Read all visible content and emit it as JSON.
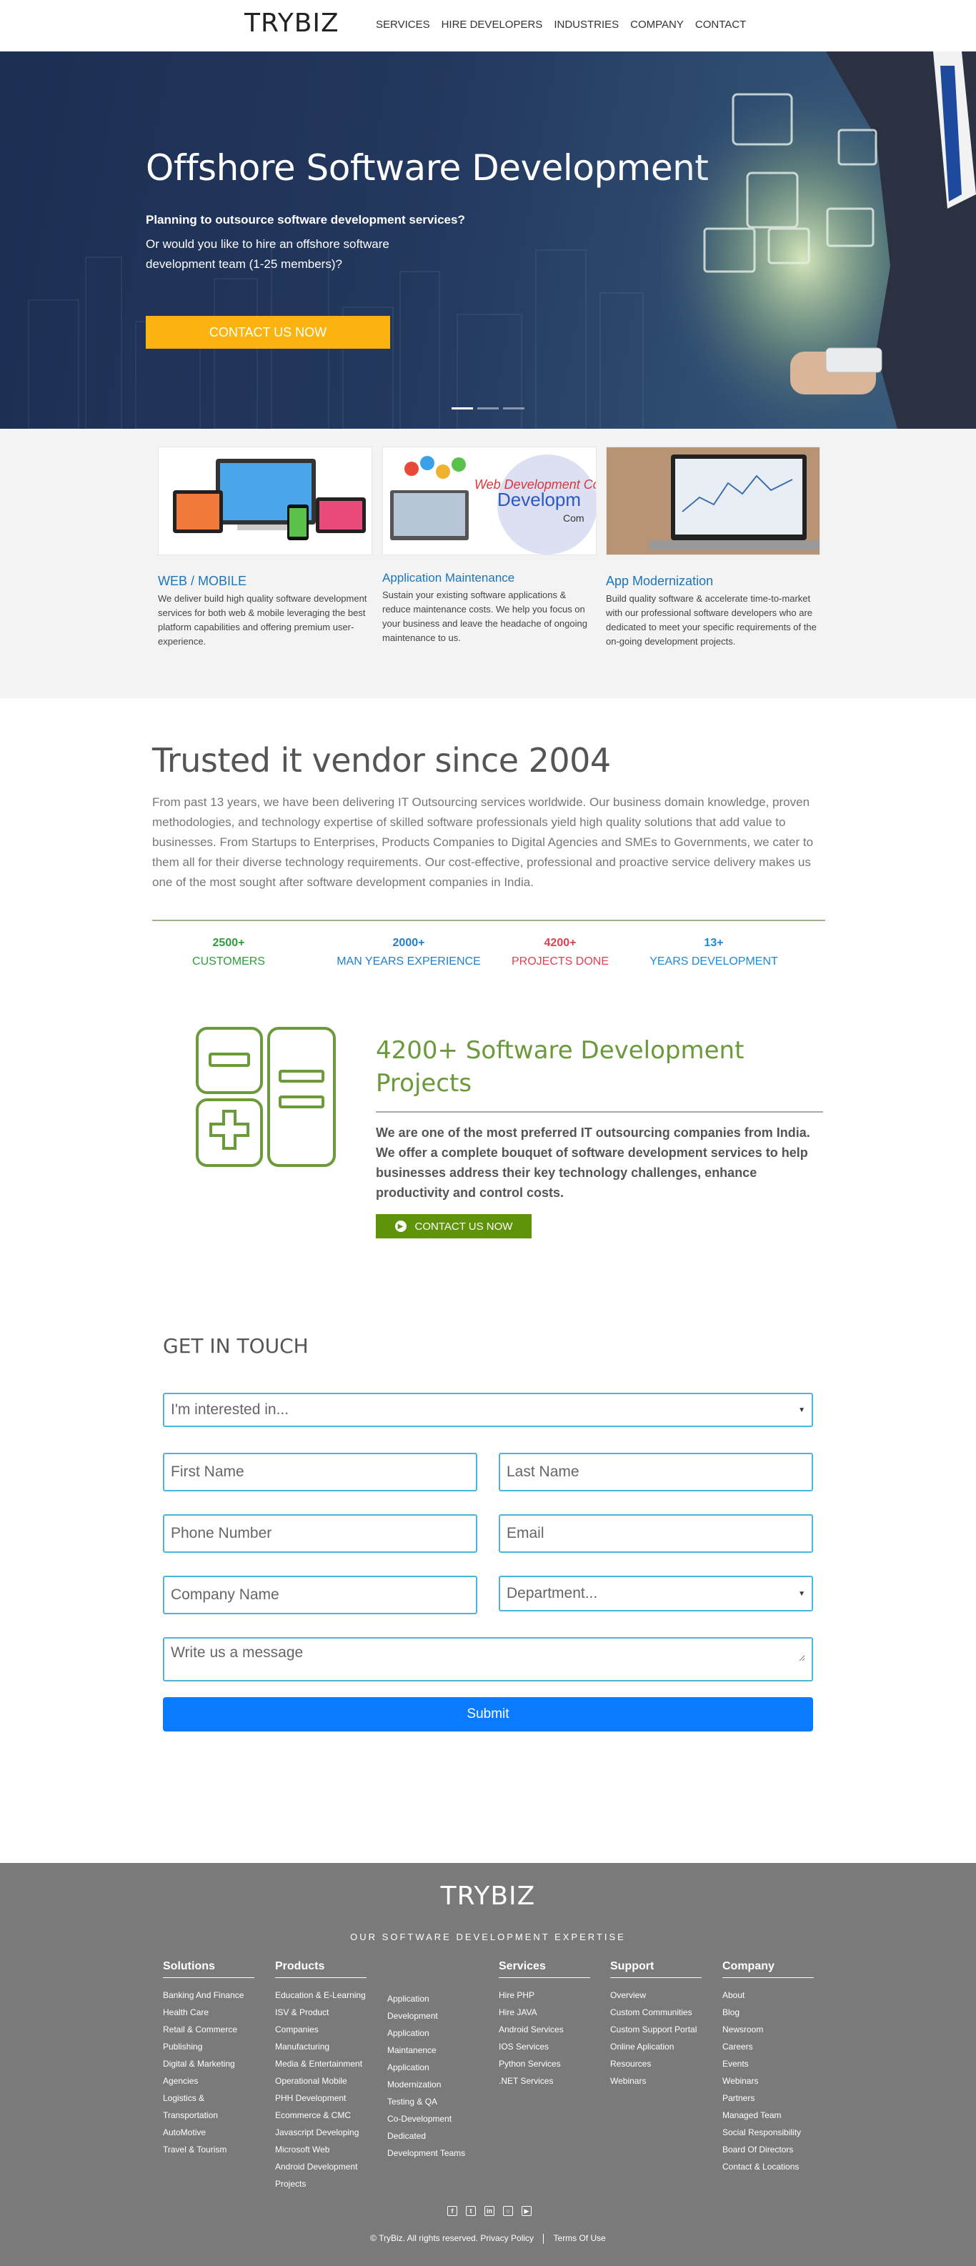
{
  "header": {
    "logo": "TRYBIZ",
    "nav": [
      "SERVICES",
      "HIRE DEVELOPERS",
      "INDUSTRIES",
      "COMPANY",
      "CONTACT"
    ]
  },
  "hero": {
    "title": "Offshore Software Development",
    "subtitle_bold": "Planning to outsource software development services?",
    "subtitle": "Or would you like to hire an offshore software development team (1-25 members)?",
    "cta": "CONTACT US NOW",
    "slides": 3,
    "active_slide": 1
  },
  "services": [
    {
      "title": "WEB / MOBILE",
      "text": "We deliver build high quality software development services for both web & mobile leveraging the best platform capabilities and offering premium user-experience.",
      "image_label": ""
    },
    {
      "title": "Application Maintenance",
      "text": "Sustain your existing software applications & reduce maintenance costs. We help you focus on your business and leave the headache of ongoing maintenance to us.",
      "image_label": "Web Development Com"
    },
    {
      "title": "App Modernization",
      "text": "Build quality software & accelerate time-to-market with our professional software developers who are dedicated to meet your specific requirements of the on-going development projects.",
      "image_label": ""
    }
  ],
  "trusted": {
    "heading": "Trusted it vendor since 2004",
    "body": "From past 13 years, we have been delivering IT Outsourcing services worldwide. Our business domain knowledge, proven methodologies, and technology expertise of skilled software professionals yield high quality solutions that add value to businesses. From Startups to Enterprises, Products Companies to Digital Agencies and SMEs to Governments, we cater to them all for their diverse technology requirements. Our cost-effective, professional and proactive service delivery makes us one of the most sought after software development companies in India.",
    "stats": [
      {
        "num": "2500+",
        "label": "CUSTOMERS",
        "color": "#2e9d3a"
      },
      {
        "num": "2000+",
        "label": "MAN YEARS EXPERIENCE",
        "color": "#1e7fcf"
      },
      {
        "num": "4200+",
        "label": "PROJECTS DONE",
        "color": "#e04050"
      },
      {
        "num": "13+",
        "label": "YEARS DEVELOPMENT",
        "color": "#1e8ad6"
      }
    ]
  },
  "projects": {
    "title": "4200+ Software Development Projects",
    "text": "We are one of the most preferred IT outsourcing companies from India. We offer a complete bouquet of software development services to help businesses address their key technology challenges, enhance productivity and control costs.",
    "cta": "CONTACT US NOW"
  },
  "contact": {
    "heading": "GET IN TOUCH",
    "interest_placeholder": "I'm interested in...",
    "first_name": "First Name",
    "last_name": "Last Name",
    "phone": "Phone Number",
    "email": "Email",
    "company": "Company Name",
    "department": "Department...",
    "message": "Write us a message",
    "submit": "Submit"
  },
  "footer": {
    "logo": "TRYBIZ",
    "tagline": "OUR SOFTWARE DEVELOPMENT EXPERTISE",
    "columns": [
      {
        "title": "Solutions",
        "items": [
          "Banking And Finance",
          "Health Care",
          "Retail & Commerce",
          "Publishing",
          "Digital & Marketing",
          "Agencies",
          "Logistics &",
          "Transportation",
          "AutoMotive",
          "Travel & Tourism"
        ]
      },
      {
        "title": "Products",
        "items": [
          "Education & E-Learning",
          "ISV & Product",
          "Companies",
          "Manufacturing",
          "Media & Entertainment",
          "Operational Mobile",
          "PHH Development",
          "Ecommerce & CMC",
          "Javascript Developing",
          "Microsoft Web",
          "Android Development",
          "Projects"
        ]
      },
      {
        "title": "",
        "items": [
          "Application",
          "Development",
          "Application",
          "Maintanence",
          "Application",
          "Modernization",
          "Testing & QA",
          "Co-Development",
          "Dedicated",
          "Development Teams"
        ]
      },
      {
        "title": "Services",
        "items": [
          "Hire PHP",
          "Hire JAVA",
          "Android Services",
          "IOS Services",
          "Python Services",
          ".NET Services"
        ]
      },
      {
        "title": "Support",
        "items": [
          "Overview",
          "Custom Communities",
          "Custom Support Portal",
          "Online Aplication",
          "Resources",
          "Webinars"
        ]
      },
      {
        "title": "Company",
        "items": [
          "About",
          "Blog",
          "Newsroom",
          "Careers",
          "Events",
          "Webinars",
          "Partners",
          "Managed Team",
          "Social Responsibility",
          "Board Of Directors",
          "Contact & Locations"
        ]
      }
    ],
    "social": [
      "facebook-icon",
      "twitter-icon",
      "linkedin-icon",
      "instagram-icon",
      "youtube-icon"
    ],
    "copyright": "© TryBiz. All rights reserved.",
    "privacy": "Privacy Policy",
    "terms": "Terms Of Use"
  }
}
